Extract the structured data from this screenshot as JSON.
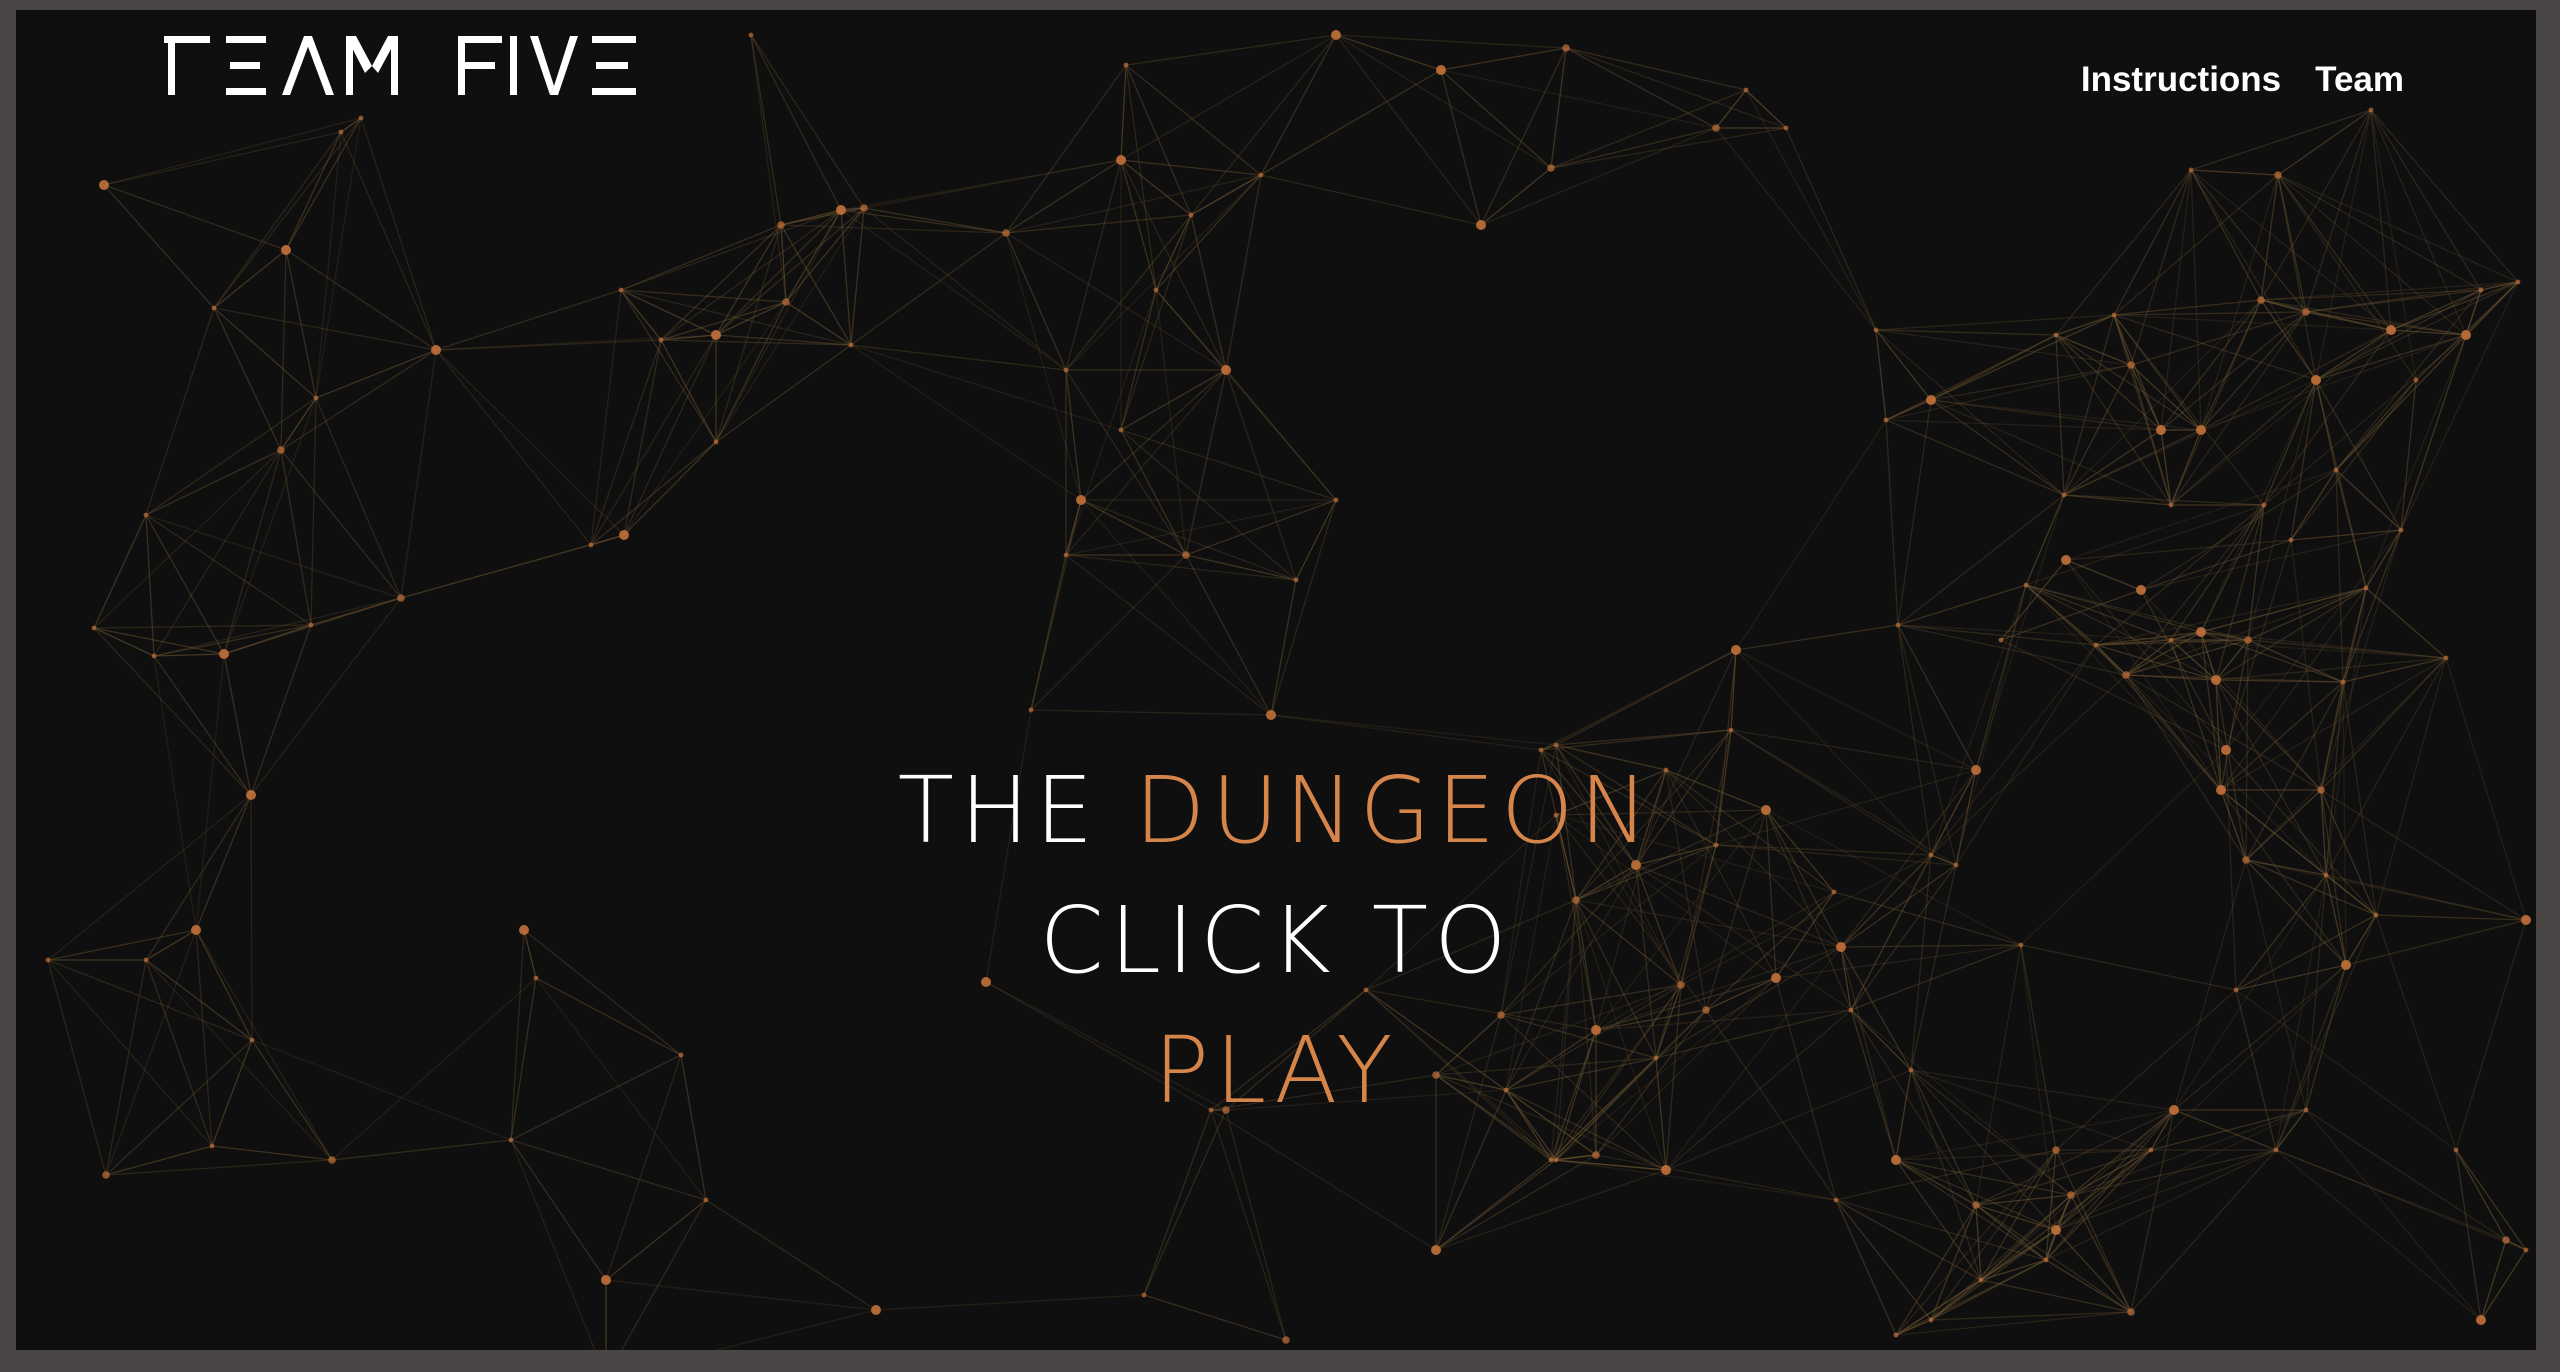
{
  "brand": {
    "logo_text": "TEAM FIVE",
    "logo_icon": "team-five-logo"
  },
  "nav": {
    "items": [
      {
        "label": "Instructions"
      },
      {
        "label": "Team"
      }
    ]
  },
  "hero": {
    "line1_prefix": "THE",
    "line1_accent": "DUNGEON",
    "line2": "CLICK TO",
    "line3": "PLAY"
  },
  "colors": {
    "background": "#0f0f0f",
    "outer_frame": "#4a4646",
    "accent": "#d6854a",
    "text": "#ffffff",
    "network_node": "#c2703a",
    "network_line": "#6b5330"
  }
}
